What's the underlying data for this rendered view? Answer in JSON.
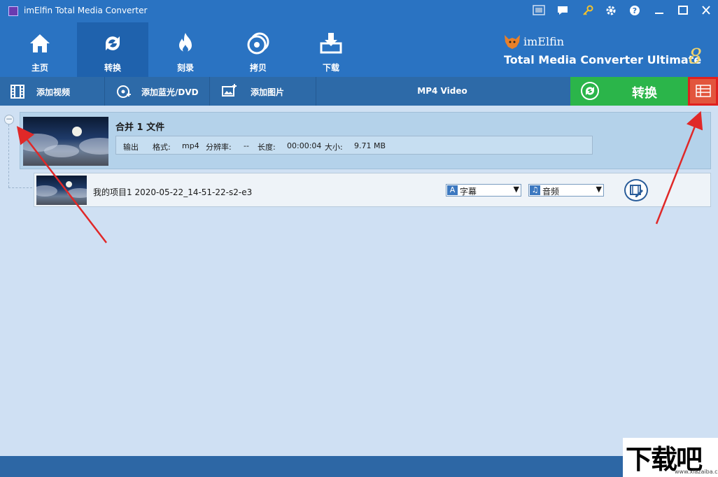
{
  "window": {
    "title": "imElfin Total Media Converter",
    "controls": [
      "minimize",
      "maximize",
      "close"
    ]
  },
  "titlebar_icons": [
    "screenshot-icon",
    "chat-icon",
    "key-icon",
    "gear-icon",
    "help-icon"
  ],
  "nav": {
    "tabs": [
      {
        "label": "主页",
        "icon": "home-icon",
        "active": false
      },
      {
        "label": "转换",
        "icon": "convert-icon",
        "active": true
      },
      {
        "label": "刻录",
        "icon": "burn-icon",
        "active": false
      },
      {
        "label": "拷贝",
        "icon": "disc-copy-icon",
        "active": false
      },
      {
        "label": "下载",
        "icon": "download-icon",
        "active": false
      }
    ]
  },
  "brand": {
    "name": "imElfin",
    "product": "Total Media Converter Ultimate",
    "version": "8"
  },
  "subtoolbar": {
    "add_video": "添加视频",
    "add_bluray": "添加蓝光/DVD",
    "add_image": "添加图片",
    "profile": "MP4 Video",
    "convert": "转换"
  },
  "merge_group": {
    "title": "合并 1 文件",
    "output_label": "输出",
    "format_label": "格式:",
    "format_value": "mp4",
    "resolution_label": "分辨率:",
    "resolution_value": "--",
    "duration_label": "长度:",
    "duration_value": "00:00:04",
    "size_label": "大小:",
    "size_value": "9.71 MB"
  },
  "item": {
    "name": "我的项目1 2020-05-22_14-51-22-s2-e3",
    "subtitle_select": "字幕",
    "audio_select": "音频"
  },
  "colors": {
    "primary": "#2a73c2",
    "convert_green": "#2bb54a",
    "highlight_red": "#e0201e",
    "content_bg": "#cfe0f3"
  },
  "watermark": {
    "text": "下载吧",
    "domain": "www.xiazaiba.com"
  }
}
